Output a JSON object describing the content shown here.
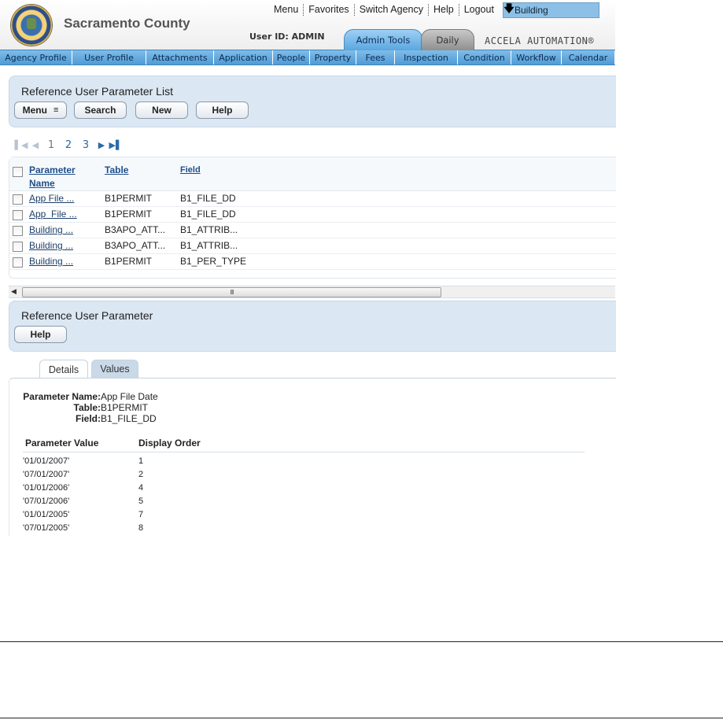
{
  "header": {
    "org_name": "Sacramento County",
    "top_links": [
      "Menu",
      "Favorites",
      "Switch Agency",
      "Help",
      "Logout"
    ],
    "module": "Building",
    "user_id": "User ID: ADMIN",
    "tabs": [
      "Admin Tools",
      "Daily"
    ],
    "brand": "ACCELA AUTOMATION®"
  },
  "nav": [
    "Agency Profile",
    "User Profile",
    "Attachments",
    "Application",
    "People",
    "Property",
    "Fees",
    "Inspection",
    "Condition",
    "Workflow",
    "Calendar"
  ],
  "list_panel": {
    "title": "Reference User Parameter List",
    "buttons": {
      "menu": "Menu",
      "search": "Search",
      "new": "New",
      "help": "Help"
    }
  },
  "pager": {
    "pages": [
      "1",
      "2",
      "3"
    ],
    "current": "1"
  },
  "table": {
    "columns": {
      "name_line1": "Parameter",
      "name_line2": "Name",
      "table": "Table",
      "field": "Field"
    },
    "rows": [
      {
        "name": "App File ...",
        "table": "B1PERMIT",
        "field": "B1_FILE_DD"
      },
      {
        "name": "App  File ...",
        "table": "B1PERMIT",
        "field": "B1_FILE_DD"
      },
      {
        "name": "Building ...",
        "table": "B3APO_ATT...",
        "field": "B1_ATTRIB..."
      },
      {
        "name": "Building ...",
        "table": "B3APO_ATT...",
        "field": "B1_ATTRIB..."
      },
      {
        "name": "Building ...",
        "table": "B1PERMIT",
        "field": "B1_PER_TYPE"
      }
    ]
  },
  "scrollbar": {
    "grip": "III"
  },
  "detail_panel": {
    "title": "Reference User Parameter",
    "help": "Help",
    "tabs": [
      "Details",
      "Values"
    ]
  },
  "details": {
    "param_name_label": "Parameter Name:",
    "param_name": "App File Date",
    "table_label": "Table:",
    "table": "B1PERMIT",
    "field_label": "Field:",
    "field": "B1_FILE_DD",
    "values_header": {
      "value": "Parameter Value",
      "order": "Display Order"
    },
    "values": [
      {
        "value": "'01/01/2007'",
        "order": "1"
      },
      {
        "value": "'07/01/2007'",
        "order": "2"
      },
      {
        "value": "'01/01/2006'",
        "order": "4"
      },
      {
        "value": "'07/01/2006'",
        "order": "5"
      },
      {
        "value": "'01/01/2005'",
        "order": "7"
      },
      {
        "value": "'07/01/2005'",
        "order": "8"
      }
    ]
  }
}
